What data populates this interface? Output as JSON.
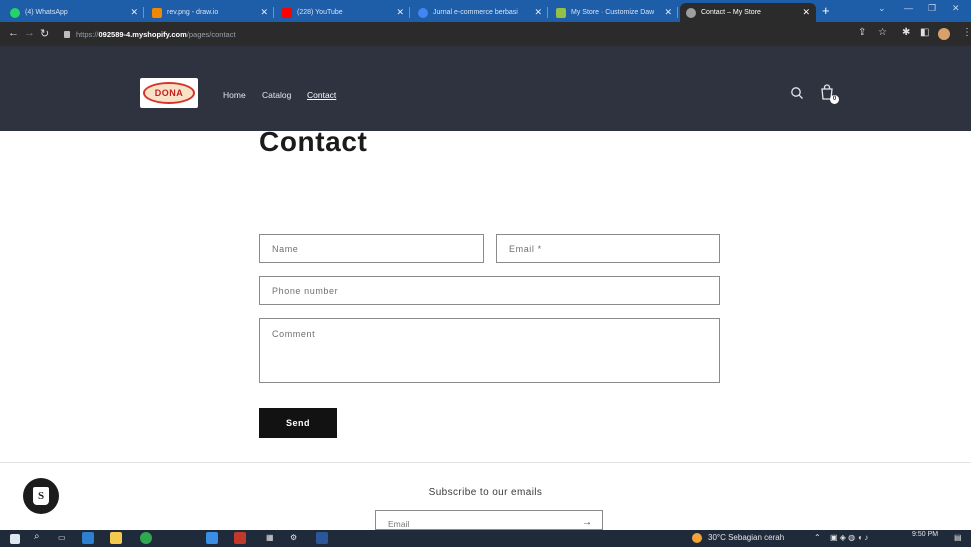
{
  "browser": {
    "tabs": [
      {
        "label": "(4) WhatsApp",
        "color": "#25d366"
      },
      {
        "label": "rev.png - draw.io",
        "color": "#f08705"
      },
      {
        "label": "(228) YouTube",
        "color": "#ff0000"
      },
      {
        "label": "Jurnal e-commerce berbasi",
        "color": "#4285f4"
      },
      {
        "label": "My Store · Customize Daw",
        "color": "#95bf47"
      },
      {
        "label": "Contact – My Store",
        "color": "#9e9e9e"
      }
    ],
    "url_prefix": "https://",
    "url_host": "092589-4.myshopify.com",
    "url_path": "/pages/contact"
  },
  "store": {
    "logo_text": "DONA",
    "nav": [
      {
        "label": "Home"
      },
      {
        "label": "Catalog"
      },
      {
        "label": "Contact"
      }
    ],
    "cart_count": "0"
  },
  "page": {
    "title": "Contact",
    "form": {
      "name_placeholder": "Name",
      "email_placeholder": "Email *",
      "phone_placeholder": "Phone number",
      "comment_placeholder": "Comment",
      "send_label": "Send"
    },
    "footer": {
      "subscribe_title": "Subscribe to our emails",
      "email_placeholder": "Email"
    }
  },
  "taskbar": {
    "weather": "30°C  Sebagian cerah",
    "time": "9:50 PM"
  },
  "colors": {
    "header_bg": "#2f3340",
    "tabstrip_bg": "#1e5da8",
    "button_bg": "#121212",
    "taskbar_bg": "#1f2a3a"
  }
}
